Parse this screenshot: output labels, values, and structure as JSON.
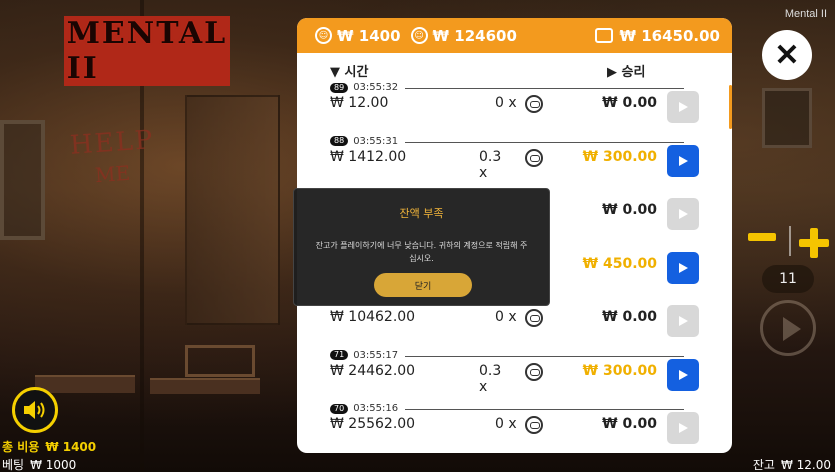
{
  "app_title": "Mental II",
  "logo_text": "MENTAL II",
  "header": {
    "bet_amount": "₩ 1400",
    "win_amount": "₩ 124600",
    "balance": "₩ 16450.00"
  },
  "columns": {
    "time": "시간",
    "win": "승리"
  },
  "rows": [
    {
      "id": "89",
      "time": "03:55:32",
      "bet": "₩ 12.00",
      "multiplier": "0 x",
      "win": "₩ 0.00",
      "highlight": false
    },
    {
      "id": "88",
      "time": "03:55:31",
      "bet": "₩ 1412.00",
      "multiplier": "0.3 x",
      "win": "₩ 300.00",
      "highlight": true
    },
    {
      "id": "",
      "time": "",
      "bet": "",
      "multiplier": "",
      "win": "₩ 0.00",
      "highlight": false
    },
    {
      "id": "",
      "time": "",
      "bet": "",
      "multiplier": "",
      "win": "₩ 450.00",
      "highlight": true
    },
    {
      "id": "",
      "time": "",
      "bet": "₩ 10462.00",
      "multiplier": "0 x",
      "win": "₩ 0.00",
      "highlight": false
    },
    {
      "id": "71",
      "time": "03:55:17",
      "bet": "₩ 24462.00",
      "multiplier": "0.3 x",
      "win": "₩ 300.00",
      "highlight": true
    },
    {
      "id": "70",
      "time": "03:55:16",
      "bet": "₩ 25562.00",
      "multiplier": "0 x",
      "win": "₩ 0.00",
      "highlight": false
    }
  ],
  "dialog": {
    "title": "잔액 부족",
    "message": "잔고가 플레이하기에 너무 낮습니다. 귀하의 계정으로 적립해 주십시오.",
    "button": "닫기"
  },
  "controls": {
    "count": "11"
  },
  "footer": {
    "total_cost_label": "총 비용",
    "total_cost_value": "₩ 1400",
    "bet_label": "베팅",
    "bet_value": "₩ 1000",
    "balance_label": "잔고",
    "balance_value": "₩ 12.00"
  },
  "colors": {
    "accent": "#f39a1e",
    "gold": "#f0b000",
    "play_active": "#1460e0"
  }
}
